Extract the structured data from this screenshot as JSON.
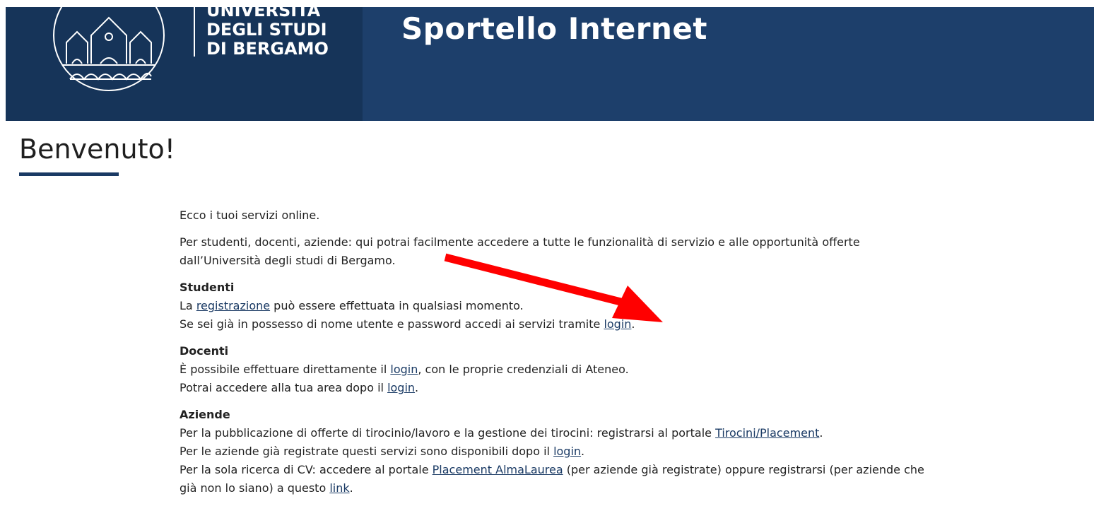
{
  "header": {
    "logo_lines": [
      "UNIVERSITÀ",
      "DEGLI STUDI",
      "DI BERGAMO"
    ],
    "site_title": "Sportello Internet",
    "colors": {
      "header_bg": "#1a3a64",
      "header_dark": "#163459",
      "header_light": "#1d3f6b"
    }
  },
  "page": {
    "title": "Benvenuto!"
  },
  "intro": {
    "line1": "Ecco i tuoi servizi online.",
    "line2": "Per studenti, docenti, aziende: qui potrai facilmente accedere a tutte le funzionalità di servizio e alle opportunità offerte dall’Università degli studi di Bergamo."
  },
  "studenti": {
    "heading": "Studenti",
    "l1_pre": "La ",
    "l1_link": "registrazione",
    "l1_post": " può essere effettuata in qualsiasi momento.",
    "l2_pre": "Se sei già in possesso di nome utente e password accedi ai servizi tramite ",
    "l2_link": "login",
    "l2_post": "."
  },
  "docenti": {
    "heading": "Docenti",
    "l1_pre": "È possibile effettuare direttamente il ",
    "l1_link": "login",
    "l1_post": ", con le proprie credenziali di Ateneo.",
    "l2_pre": "Potrai accedere alla tua area dopo il ",
    "l2_link": "login",
    "l2_post": "."
  },
  "aziende": {
    "heading": "Aziende",
    "l1_pre": "Per la pubblicazione di offerte di tirocinio/lavoro e la gestione dei tirocini: registrarsi al portale ",
    "l1_link": "Tirocini/Placement",
    "l1_post": ".",
    "l2_pre": "Per le aziende già registrate questi servizi sono disponibili dopo il ",
    "l2_link": "login",
    "l2_post": ".",
    "l3_pre": "Per la sola ricerca di CV: accedere al portale ",
    "l3_link": "Placement AlmaLaurea",
    "l3_mid": " (per aziende già registrate) oppure registrarsi (per aziende che già non lo siano) a questo ",
    "l3_link2": "link",
    "l3_post": "."
  },
  "annotation": {
    "arrow_icon": "red-arrow-icon",
    "arrow_color": "#ff0000"
  }
}
